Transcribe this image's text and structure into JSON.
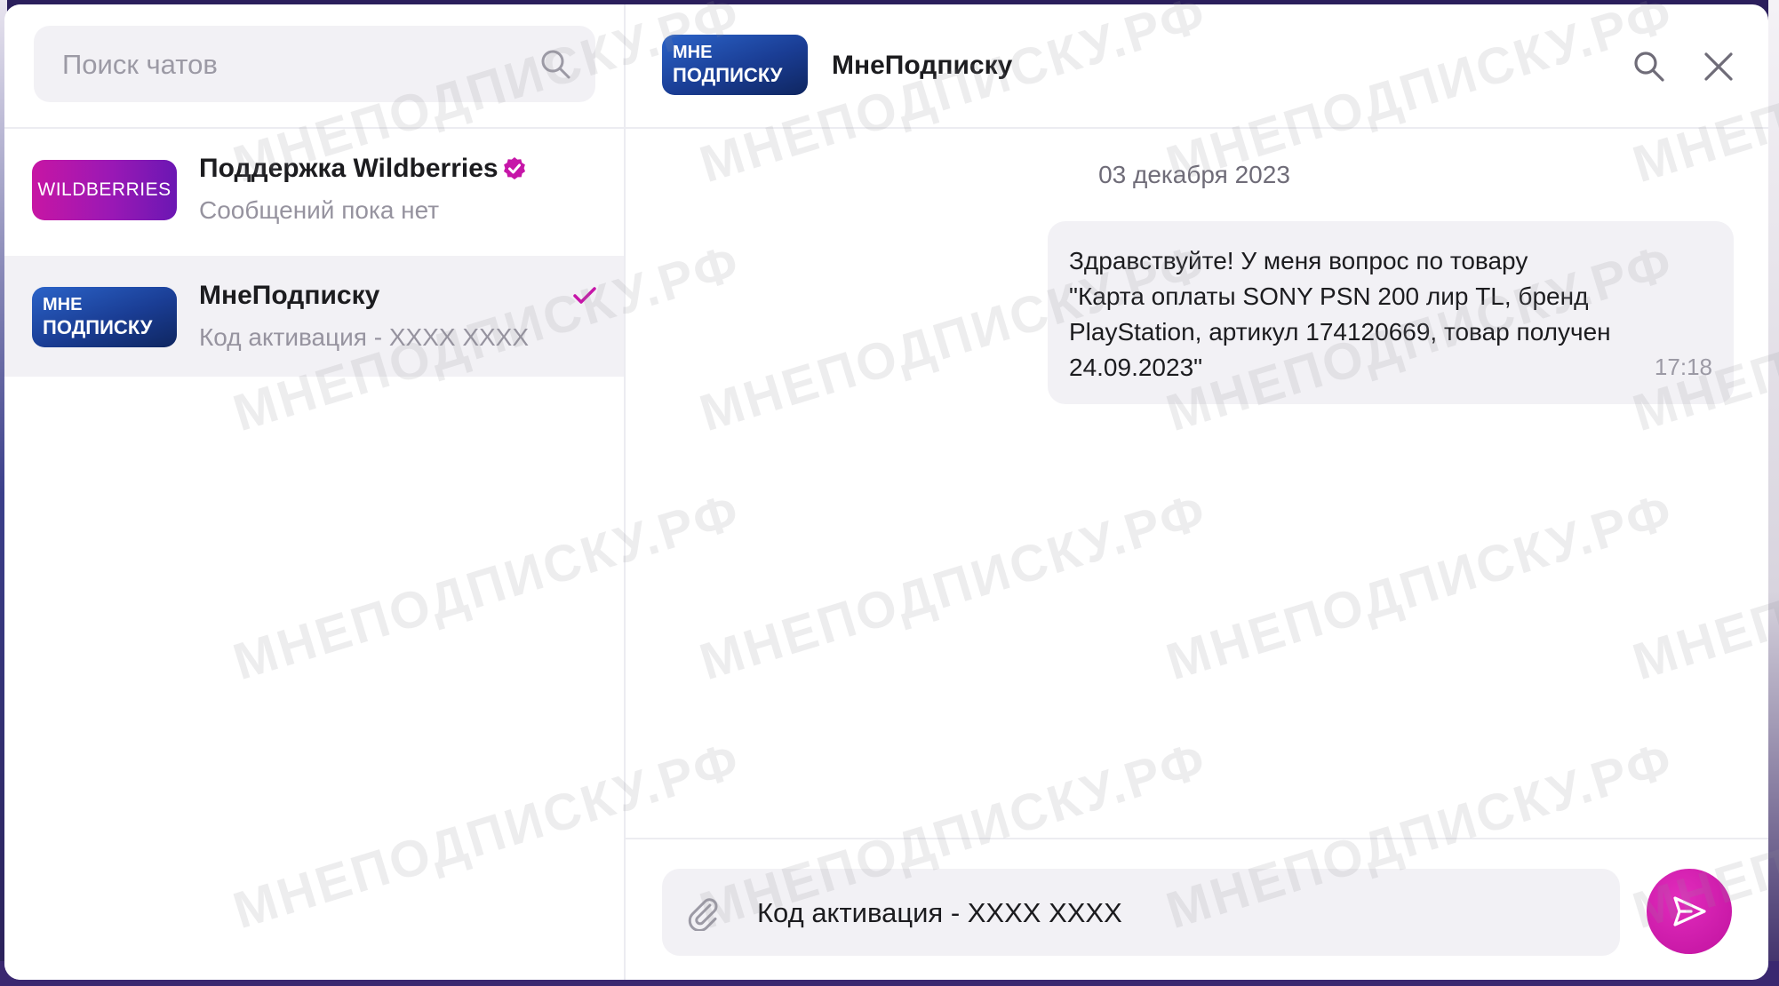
{
  "sidebar": {
    "search_placeholder": "Поиск чатов",
    "chats": [
      {
        "name": "Поддержка Wildberries",
        "preview": "Сообщений пока нет",
        "avatar_text": "WILDBERRIES",
        "verified": true
      },
      {
        "name": "МнеПодписку",
        "preview": "Код активация - XXXX XXXX",
        "avatar_line1": "МНЕ",
        "avatar_line2": "ПОДПИСКУ",
        "selected": true,
        "read": true
      }
    ]
  },
  "conversation": {
    "title": "МнеПодписку",
    "avatar_line1": "МНЕ",
    "avatar_line2": "ПОДПИСКУ",
    "date": "03 декабря 2023",
    "messages": [
      {
        "text": "Здравствуйте! У меня вопрос по товару\n\"Карта оплаты SONY PSN 200 лир TL, бренд\nPlayStation, артикул 174120669, товар получен\n24.09.2023\"",
        "time": "17:18"
      }
    ]
  },
  "composer": {
    "value": "Код активация - XXXX XXXX"
  },
  "watermark": {
    "text": "МНЕПОДПИСКУ.РФ"
  },
  "colors": {
    "accent": "#d6179b",
    "bubble": "#f2f1f5",
    "brand_wb": "#b017b0",
    "brand_mp": "#1a3d94"
  }
}
